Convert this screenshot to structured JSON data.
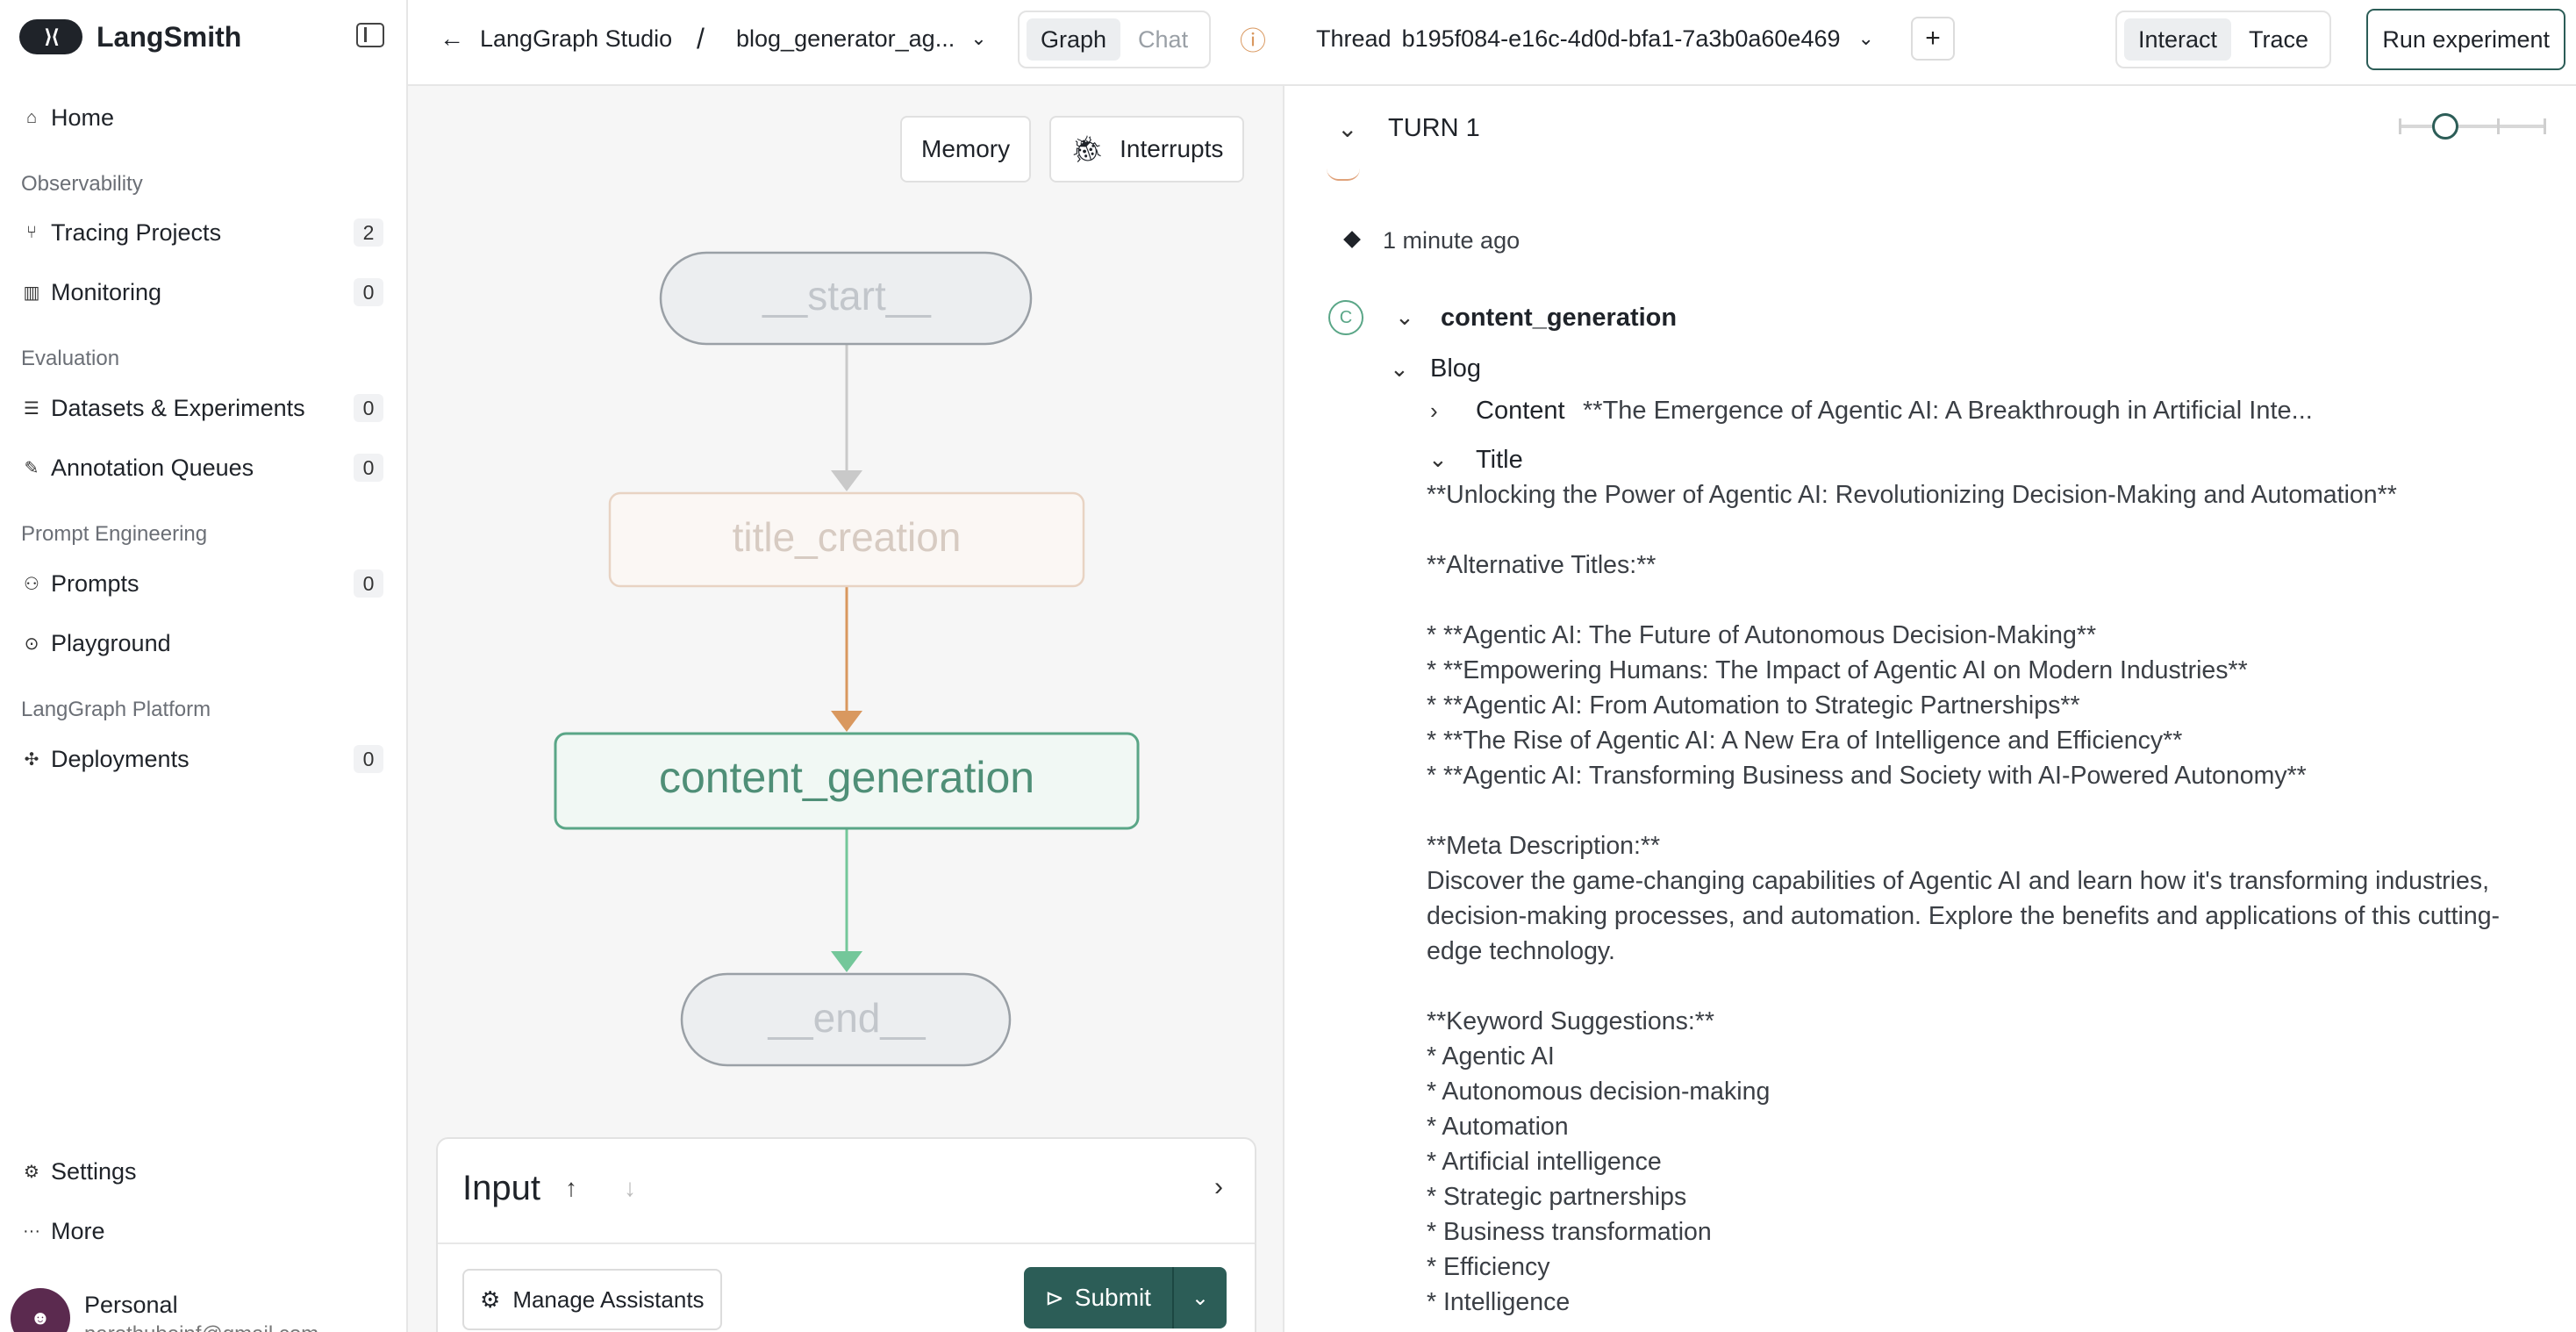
{
  "sidebar": {
    "brand": "LangSmith",
    "items": [
      {
        "label": "Home"
      },
      {
        "label": "Tracing Projects",
        "count": "2"
      },
      {
        "label": "Monitoring",
        "count": "0"
      },
      {
        "label": "Datasets & Experiments",
        "count": "0"
      },
      {
        "label": "Annotation Queues",
        "count": "0"
      },
      {
        "label": "Prompts",
        "count": "0"
      },
      {
        "label": "Playground"
      },
      {
        "label": "Deployments",
        "count": "0"
      },
      {
        "label": "Settings"
      },
      {
        "label": "More"
      }
    ],
    "sections": [
      "Observability",
      "Evaluation",
      "Prompt Engineering",
      "LangGraph Platform"
    ],
    "user": {
      "name": "Personal",
      "email": "narothubeinf@gmail.com"
    }
  },
  "topbar": {
    "back_label": "LangGraph Studio",
    "separator": "/",
    "graph_name": "blog_generator_ag...",
    "view_tabs": [
      "Graph",
      "Chat"
    ],
    "thread_label": "Thread",
    "thread_id": "b195f084-e16c-4d0d-bfa1-7a3b0a60e469",
    "mode_tabs": [
      "Interact",
      "Trace"
    ],
    "run_label": "Run experiment"
  },
  "graph": {
    "memory_label": "Memory",
    "interrupts_label": "Interrupts",
    "nodes": [
      {
        "label": "__start__",
        "state": "idle"
      },
      {
        "label": "title_creation",
        "state": "done"
      },
      {
        "label": "content_generation",
        "state": "active"
      },
      {
        "label": "__end__",
        "state": "idle"
      }
    ],
    "input": {
      "title": "Input",
      "manage_label": "Manage Assistants",
      "submit_label": "Submit"
    }
  },
  "thread": {
    "turn_label": "TURN 1",
    "timestamp": "1 minute ago",
    "node_badge": "C",
    "node_name": "content_generation",
    "blog_label": "Blog",
    "content_label": "Content",
    "content_preview": "**The Emergence of Agentic AI: A Breakthrough in Artificial Inte...",
    "title_label": "Title",
    "title_text": "**Unlocking the Power of Agentic AI: Revolutionizing Decision-Making and Automation**\n\n**Alternative Titles:**\n\n* **Agentic AI: The Future of Autonomous Decision-Making**\n* **Empowering Humans: The Impact of Agentic AI on Modern Industries**\n* **Agentic AI: From Automation to Strategic Partnerships**\n* **The Rise of Agentic AI: A New Era of Intelligence and Efficiency**\n* **Agentic AI: Transforming Business and Society with AI-Powered Autonomy**\n\n**Meta Description:**\nDiscover the game-changing capabilities of Agentic AI and learn how it's transforming industries, decision-making processes, and automation. Explore the benefits and applications of this cutting-edge technology.\n\n**Keyword Suggestions:**\n* Agentic AI\n* Autonomous decision-making\n* Automation\n* Artificial intelligence\n* Strategic partnerships\n* Business transformation\n* Efficiency\n* Intelligence"
  },
  "colors": {
    "accent": "#2c5d57",
    "active_node_border": "#5aa687",
    "done_node_border": "#e8d3c3",
    "done_edge": "#d9985f",
    "active_edge": "#74c79a"
  }
}
